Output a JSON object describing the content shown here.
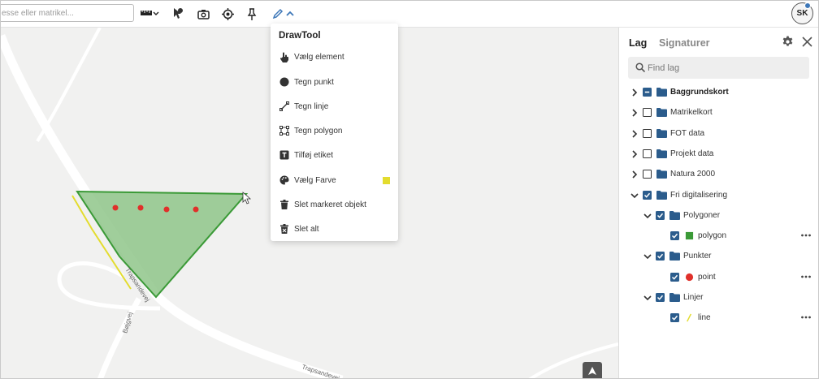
{
  "toolbar": {
    "search_placeholder": "esse eller matrikel..."
  },
  "user": {
    "initials": "SK"
  },
  "map": {
    "road_labels": [
      "Trapsandevej",
      "Bøjgvej",
      "Trapsandevej"
    ]
  },
  "drawtool": {
    "title": "DrawTool",
    "items": [
      {
        "label": "Vælg element",
        "icon": "hand-pointer-icon"
      },
      {
        "label": "Tegn punkt",
        "icon": "circle-icon"
      },
      {
        "label": "Tegn linje",
        "icon": "line-icon"
      },
      {
        "label": "Tegn polygon",
        "icon": "polygon-icon"
      },
      {
        "label": "Tilføj etiket",
        "icon": "text-box-icon"
      },
      {
        "label": "Vælg Farve",
        "icon": "palette-icon"
      },
      {
        "label": "Slet markeret objekt",
        "icon": "trash-icon"
      },
      {
        "label": "Slet alt",
        "icon": "trash-all-icon"
      }
    ],
    "selected_color": "#e3dc2e"
  },
  "panel": {
    "tabs": [
      "Lag",
      "Signaturer"
    ],
    "search_placeholder": "Find lag",
    "layers": [
      {
        "label": "Baggrundskort",
        "state": "indeterminate",
        "expanded": false,
        "bold": true
      },
      {
        "label": "Matrikelkort",
        "state": "unchecked",
        "expanded": false
      },
      {
        "label": "FOT data",
        "state": "unchecked",
        "expanded": false
      },
      {
        "label": "Projekt data",
        "state": "unchecked",
        "expanded": false
      },
      {
        "label": "Natura 2000",
        "state": "unchecked",
        "expanded": false
      },
      {
        "label": "Fri digitalisering",
        "state": "checked",
        "expanded": true
      },
      {
        "label": "Polygoner",
        "state": "checked",
        "expanded": true
      },
      {
        "label": "polygon",
        "state": "checked",
        "symbol": "square"
      },
      {
        "label": "Punkter",
        "state": "checked",
        "expanded": true
      },
      {
        "label": "point",
        "state": "checked",
        "symbol": "circle"
      },
      {
        "label": "Linjer",
        "state": "checked",
        "expanded": true
      },
      {
        "label": "line",
        "state": "checked",
        "symbol": "line"
      }
    ]
  },
  "colors": {
    "accent": "#2b5c8c",
    "polygon_fill": "#8fc58a",
    "polygon_stroke": "#3b9a37",
    "point": "#e0302a",
    "line": "#e3dc2e",
    "edit_blue": "#3d77b8"
  }
}
